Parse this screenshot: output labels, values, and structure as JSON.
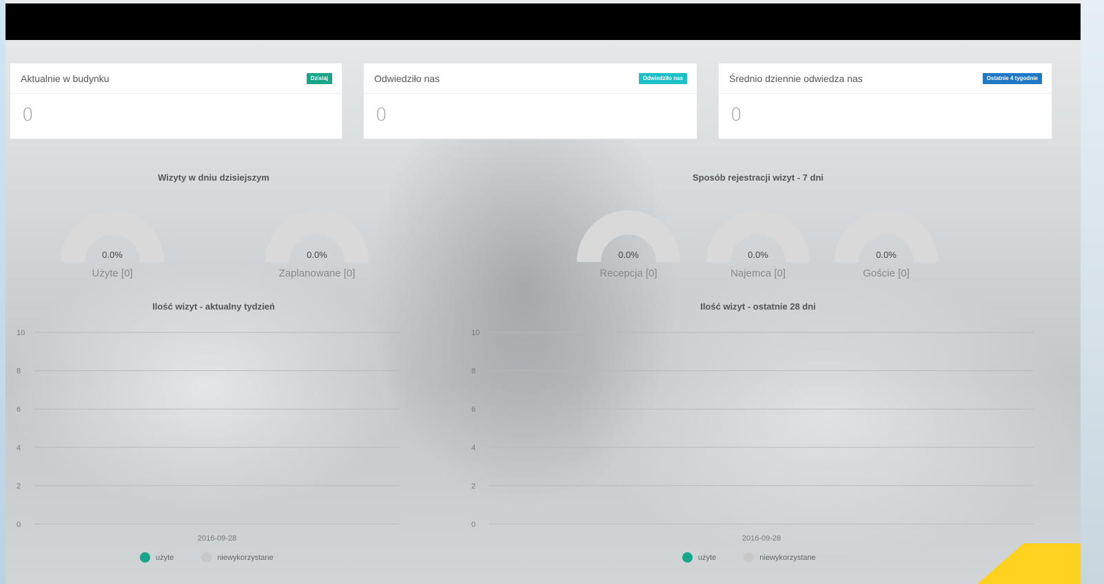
{
  "cards": [
    {
      "title": "Aktualnie w budynku",
      "badge": "Dzisiaj",
      "badge_color": "#17a689",
      "value": "0"
    },
    {
      "title": "Odwiedziło nas",
      "badge": "Odwiedziło nas",
      "badge_color": "#1ec0c8",
      "value": "0"
    },
    {
      "title": "Średnio dziennie odwiedza nas",
      "badge": "Ostatnie 4 tygodnie",
      "badge_color": "#1f79c6",
      "value": "0"
    }
  ],
  "visits_today": {
    "title": "Wizyty w dniu dzisiejszym",
    "gauges": [
      {
        "value": "0.0%",
        "label": "Użyte [0]",
        "fraction": 0
      },
      {
        "value": "0.0%",
        "label": "Zaplanowane [0]",
        "fraction": 0
      }
    ]
  },
  "registration_method": {
    "title": "Sposób rejestracji wizyt - 7 dni",
    "gauges": [
      {
        "value": "0.0%",
        "label": "Recepcja [0]",
        "fraction": 0
      },
      {
        "value": "0.0%",
        "label": "Najemca [0]",
        "fraction": 0
      },
      {
        "value": "0.0%",
        "label": "Goście [0]",
        "fraction": 0
      }
    ]
  },
  "chart_data": [
    {
      "type": "line",
      "title": "Ilość wizyt - aktualny tydzień",
      "x": [
        "2016-09-28"
      ],
      "ylim": [
        0,
        10
      ],
      "yticks": [
        "0",
        "2",
        "4",
        "6",
        "8",
        "10"
      ],
      "grid": true,
      "series": [
        {
          "name": "użyte",
          "color": "#17a689",
          "values": [
            0
          ]
        },
        {
          "name": "niewykorzystane",
          "color": "#c8c8c8",
          "values": [
            0
          ]
        }
      ],
      "legend": "bottom"
    },
    {
      "type": "line",
      "title": "Ilość wizyt - ostatnie 28 dni",
      "x": [
        "2016-09-28"
      ],
      "ylim": [
        0,
        10
      ],
      "yticks": [
        "0",
        "2",
        "4",
        "6",
        "8",
        "10"
      ],
      "grid": true,
      "series": [
        {
          "name": "użyte",
          "color": "#17a689",
          "values": [
            0
          ]
        },
        {
          "name": "niewykorzystane",
          "color": "#c8c8c8",
          "values": [
            0
          ]
        }
      ],
      "legend": "bottom"
    }
  ]
}
